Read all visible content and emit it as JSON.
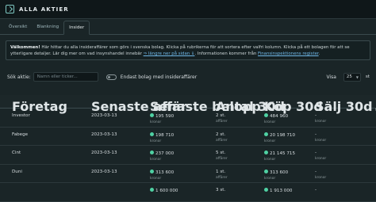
{
  "header": {
    "title": "ALLA AKTIER"
  },
  "tabs": [
    {
      "label": "Översikt",
      "active": false
    },
    {
      "label": "Blankning",
      "active": false
    },
    {
      "label": "Insider",
      "active": true
    }
  ],
  "info": {
    "bold": "Välkommen!",
    "line1": " Här hittar du alla insideraffärer som görs i svenska bolag. Klicka på rubrikerna för att sortera efter valfri kolumn. Klicka på ett bolagen för att se",
    "line2a": "ytterligare detaljer. Lär dig mer om vad insynshandel innebär ",
    "link1": "⇒ längre ner på sidan ⇓",
    "line2b": ". Informationen kommer från ",
    "link2": "Finansinspektionens register",
    "line2c": "."
  },
  "controls": {
    "search_label": "Sök aktie:",
    "search_placeholder": "Namn eller ticker...",
    "toggle_label": "Endast bolag med insideraffärer",
    "show_label": "Visa",
    "show_value": "25",
    "show_suffix": "st"
  },
  "table": {
    "columns": [
      "Företag",
      "Senaste affär",
      "Senaste belopp",
      "Antal 30d",
      "Köp 30d",
      "Sälj 30d"
    ],
    "rows": [
      {
        "company": "Investor",
        "date": "2023-03-13",
        "amount": "195 590",
        "amount_unit": "kronor",
        "count": "2 st.",
        "count_unit": "affärer",
        "buy": "484 960",
        "buy_unit": "kronor",
        "sell": "-",
        "sell_unit": "kronor"
      },
      {
        "company": "Fabege",
        "date": "2023-03-13",
        "amount": "198 710",
        "amount_unit": "kronor",
        "count": "2 st.",
        "count_unit": "affärer",
        "buy": "20 198 710",
        "buy_unit": "kronor",
        "sell": "-",
        "sell_unit": "kronor"
      },
      {
        "company": "Cint",
        "date": "2023-03-13",
        "amount": "237 000",
        "amount_unit": "kronor",
        "count": "5 st.",
        "count_unit": "affärer",
        "buy": "21 145 715",
        "buy_unit": "kronor",
        "sell": "-",
        "sell_unit": "kronor"
      },
      {
        "company": "Duni",
        "date": "2023-03-13",
        "amount": "313 600",
        "amount_unit": "kronor",
        "count": "1 st.",
        "count_unit": "affärer",
        "buy": "313 600",
        "buy_unit": "kronor",
        "sell": "-",
        "sell_unit": "kronor"
      },
      {
        "company": "",
        "date": "",
        "amount": "1 600 000",
        "amount_unit": "",
        "count": "3 st.",
        "count_unit": "",
        "buy": "1 913 000",
        "buy_unit": "",
        "sell": "-",
        "sell_unit": ""
      }
    ]
  }
}
